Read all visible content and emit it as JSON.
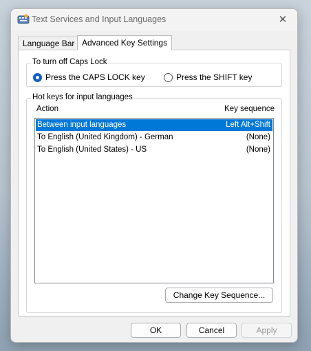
{
  "window": {
    "title": "Text Services and Input Languages",
    "close_glyph": "✕"
  },
  "tabs": [
    {
      "label": "Language Bar"
    },
    {
      "label": "Advanced Key Settings"
    }
  ],
  "caps_lock": {
    "group_label": "To turn off Caps Lock",
    "options": [
      {
        "label": "Press the CAPS LOCK key",
        "checked": true
      },
      {
        "label": "Press the SHIFT key",
        "checked": false
      }
    ]
  },
  "hotkeys": {
    "group_label": "Hot keys for input languages",
    "col_action": "Action",
    "col_sequence": "Key sequence",
    "rows": [
      {
        "action": "Between input languages",
        "sequence": "Left Alt+Shift",
        "selected": true
      },
      {
        "action": "To English (United Kingdom) - German",
        "sequence": "(None)",
        "selected": false
      },
      {
        "action": "To English (United States) - US",
        "sequence": "(None)",
        "selected": false
      }
    ],
    "change_button": "Change Key Sequence..."
  },
  "footer": {
    "ok": "OK",
    "cancel": "Cancel",
    "apply": "Apply"
  },
  "colors": {
    "selection": "#0078d7",
    "radio_accent": "#0f5fbf"
  }
}
